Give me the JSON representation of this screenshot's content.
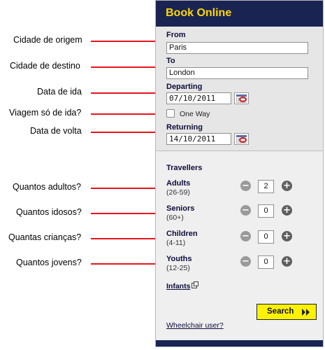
{
  "annotations": [
    "Cidade de origem",
    "Cidade de destino",
    "Data de ida",
    "Viagem só de ida?",
    "Data de volta",
    "Quantos adultos?",
    "Quantos idosos?",
    "Quantas crianças?",
    "Quantos jovens?"
  ],
  "widget": {
    "title": "Book Online",
    "from_label": "From",
    "from_value": "Paris",
    "to_label": "To",
    "to_value": "London",
    "departing_label": "Departing",
    "departing_value": "07/10/2011",
    "one_way_label": "One Way",
    "one_way_checked": false,
    "returning_label": "Returning",
    "returning_value": "14/10/2011",
    "travellers_label": "Travellers",
    "adults_label": "Adults",
    "adults_range": "(26-59)",
    "adults_count": "2",
    "seniors_label": "Seniors",
    "seniors_range": "(60+)",
    "seniors_count": "0",
    "children_label": "Children",
    "children_range": "(4-11)",
    "children_count": "0",
    "youths_label": "Youths",
    "youths_range": "(12-25)",
    "youths_count": "0",
    "infants_label": "Infants",
    "search_label": "Search",
    "wheelchair_label": "Wheelchair user?"
  },
  "colors": {
    "header_bg": "#192453",
    "title_color": "#ffd700",
    "arrow_color": "#e8141c",
    "search_bg": "#fff200"
  },
  "icons": [
    "calendar-icon",
    "minus-icon",
    "plus-icon",
    "external-window-icon",
    "double-chevron-icon"
  ]
}
